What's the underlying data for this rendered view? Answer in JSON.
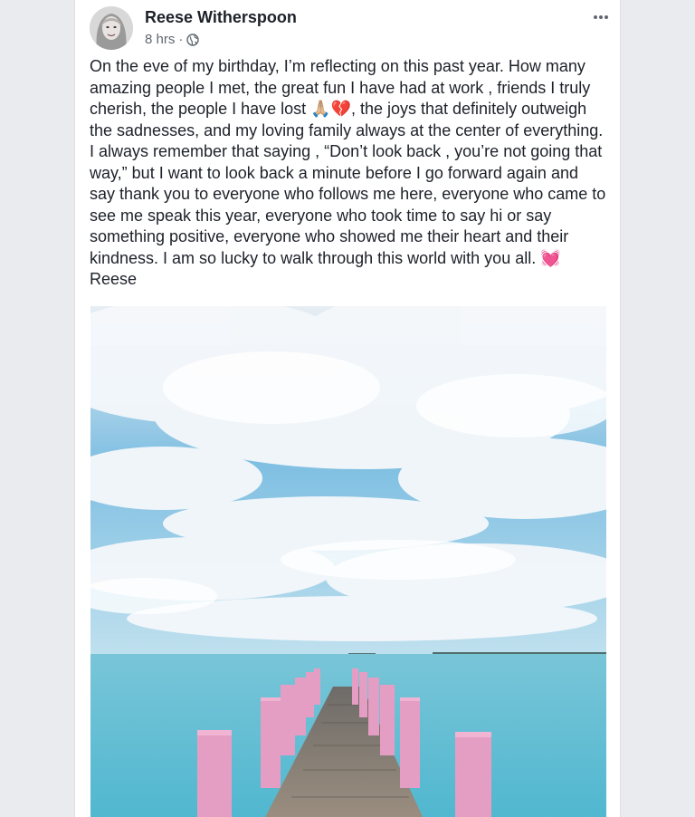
{
  "post": {
    "author": "Reese Witherspoon",
    "time": "8 hrs",
    "separator": "·",
    "privacy_icon": "globe-icon",
    "menu_icon": "more-options-icon",
    "text": "On the eve of my birthday, I’m reflecting on this past year. How many amazing people I met, the great fun I have had at work , friends I truly cherish, the people I have lost 🙏🏼💔, the joys that definitely outweigh the sadnesses, and my loving family always at the center of everything. I always remember that saying , “Don’t look back , you’re not going that way,” but I want to look back a minute before I go forward again and say thank you to everyone who follows me here, everyone who came to see me speak this year, everyone who took time to say hi or say something positive, everyone who showed me their heart and their kindness. I am so lucky to walk through this world with you all. 💓Reese",
    "photo": {
      "icon": "photo-sea-pier-image",
      "colors": {
        "sky": "#5fb0dc",
        "cloud": "#f4f7fa",
        "sea": "#6cc3d6",
        "pier_post": "#e59ec3",
        "boardwalk": "#8c8379"
      }
    }
  },
  "colors": {
    "page_bg": "#e9ebee",
    "card_bg": "#ffffff",
    "text": "#1d2129",
    "meta": "#606770"
  }
}
